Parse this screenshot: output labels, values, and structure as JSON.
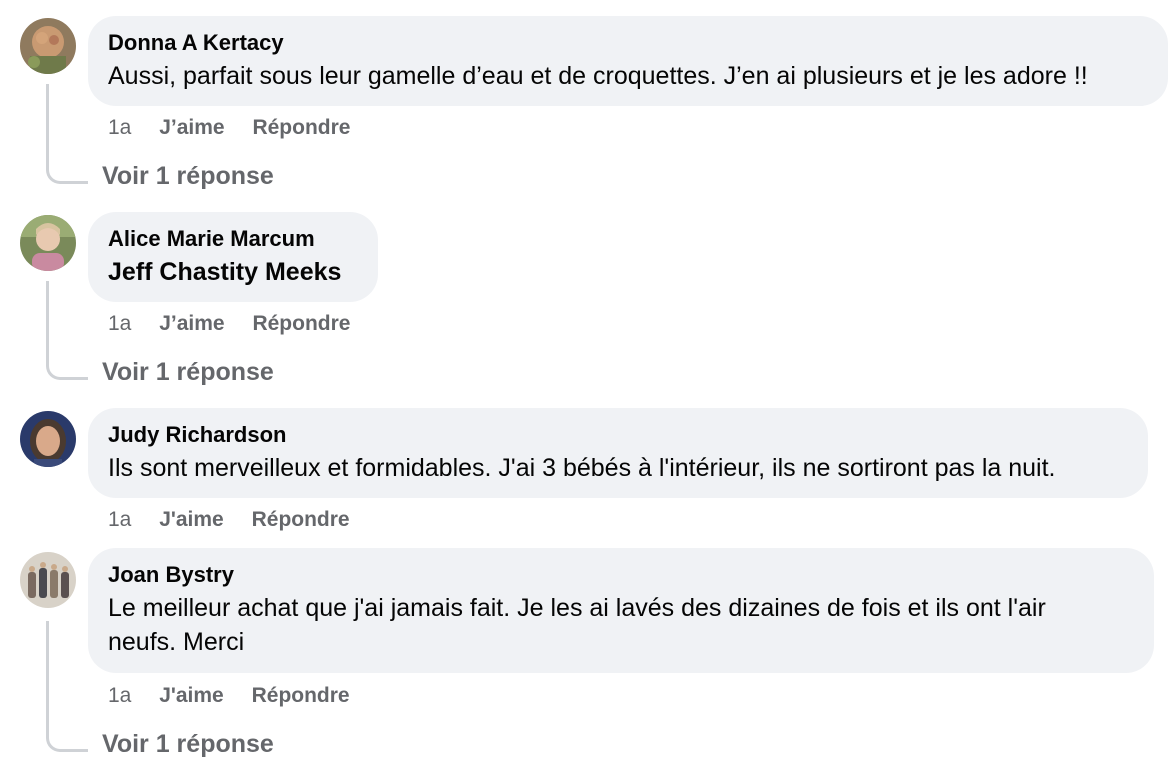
{
  "comments": [
    {
      "author": "Donna A Kertacy",
      "text": "Aussi, parfait sous leur gamelle d’eau et de croquettes. J’en ai plusieurs et je les adore !!",
      "time": "1a",
      "like": "J’aime",
      "reply": "Répondre",
      "view_replies": "Voir 1 réponse",
      "avatar_colors": [
        "#9c7a5a",
        "#c9a37a",
        "#6f7a4a"
      ]
    },
    {
      "author": "Alice Marie Marcum",
      "text": "Jeff Chastity Meeks",
      "time": "1a",
      "like": "J’aime",
      "reply": "Répondre",
      "view_replies": "Voir 1 réponse",
      "avatar_colors": [
        "#7a8a5a",
        "#e8c9b0",
        "#c98aa0"
      ]
    },
    {
      "author": "Judy Richardson",
      "text": "Ils sont merveilleux et formidables. J'ai 3 bébés à l'intérieur, ils ne sortiront pas la nuit.",
      "time": "1a",
      "like": "J'aime",
      "reply": "Répondre",
      "avatar_colors": [
        "#2a3a6a",
        "#d9a98a",
        "#4a3a30"
      ]
    },
    {
      "author": "Joan Bystry",
      "text_line1": "Le meilleur achat que j'ai jamais fait. Je les ai lavés des dizaines de fois et ils ont l'air",
      "text_line2": "neufs. Merci",
      "time": "1a",
      "like": "J'aime",
      "reply": "Répondre",
      "view_replies": "Voir 1 réponse",
      "avatar_colors": [
        "#d8d2c8",
        "#7a6a60",
        "#4a4a50"
      ]
    }
  ]
}
